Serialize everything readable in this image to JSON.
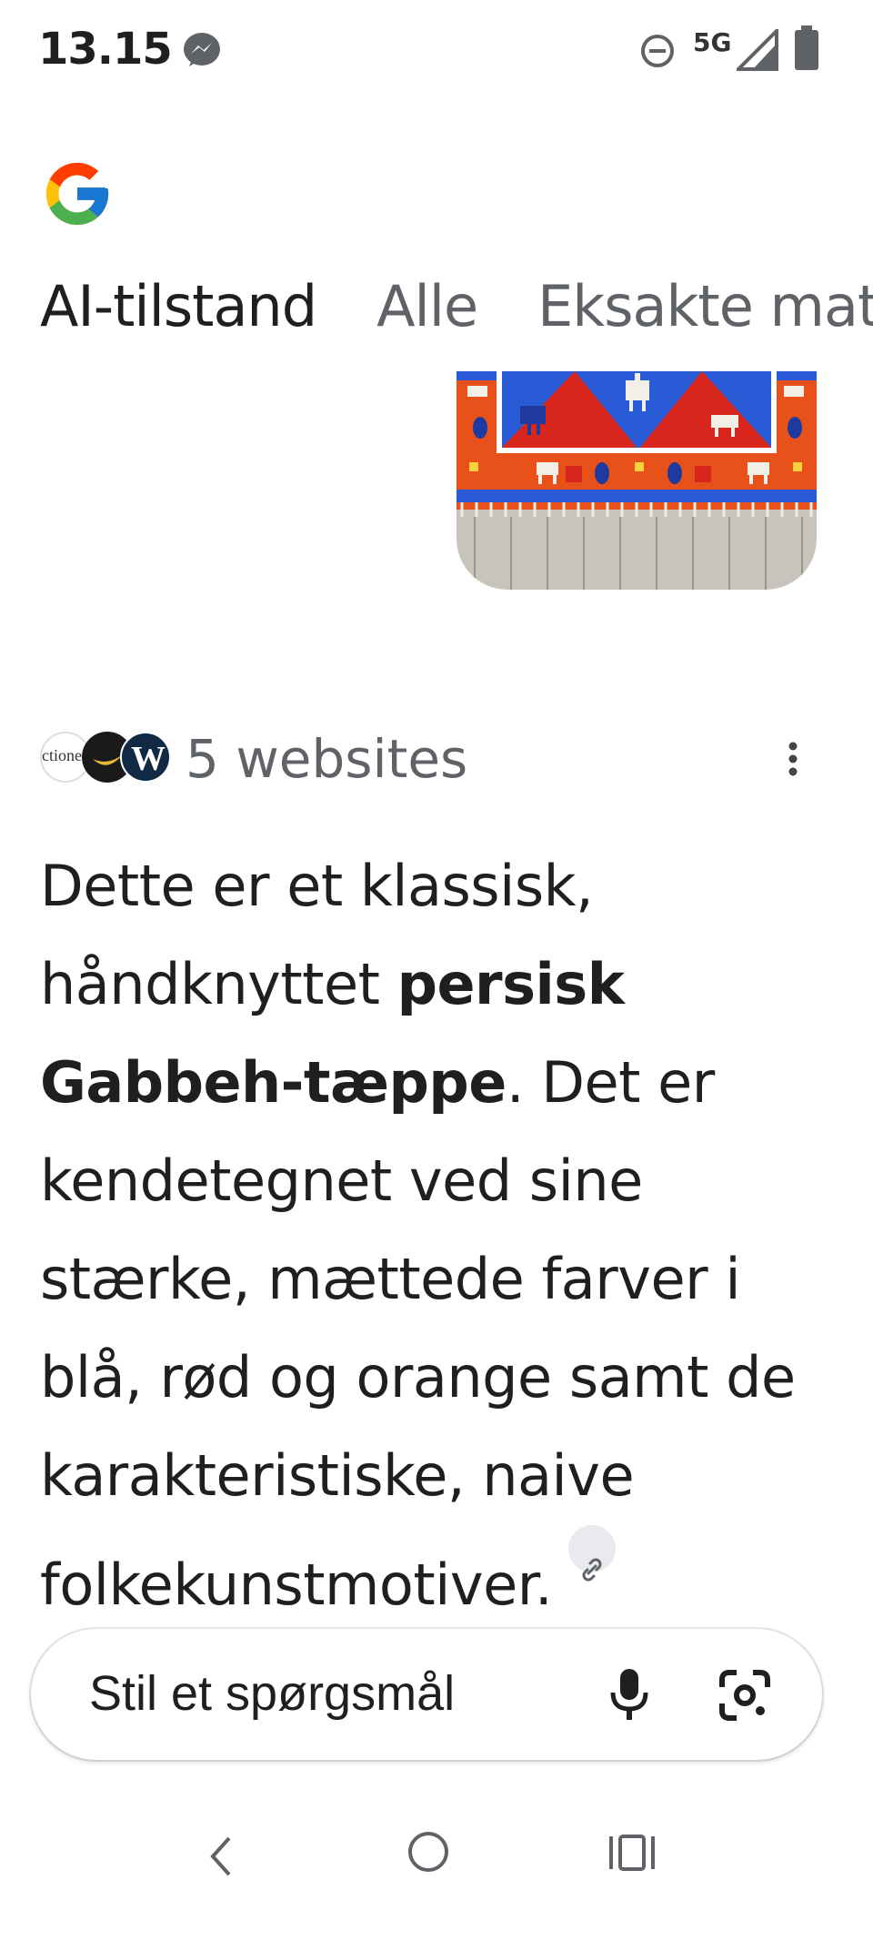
{
  "status_bar": {
    "time": "13.15",
    "network": "5G",
    "icons": [
      "messenger-icon",
      "do-not-disturb-icon",
      "signal-icon",
      "battery-icon"
    ]
  },
  "header": {
    "logo": "google-logo"
  },
  "tabs": [
    {
      "label": "AI-tilstand",
      "active": true
    },
    {
      "label": "Alle",
      "active": false
    },
    {
      "label": "Eksakte mat",
      "active": false
    }
  ],
  "sources": {
    "label": "5 websites",
    "favicon_texts": [
      "ctione",
      "W"
    ]
  },
  "answer": {
    "part1": "Dette er et klassisk, håndknyttet ",
    "bold1": "persisk Gabbeh-tæppe",
    "part2": ". Det er kendetegnet ved sine stærke, mættede farver i blå, rød og orange samt de karakteristiske, naive folkekunstmotiver."
  },
  "ask": {
    "placeholder": "Stil et spørgsmål"
  },
  "colors": {
    "active_tab": "#1f1f1f",
    "inactive_tab": "#5f6368",
    "rug_blue": "#2a5bd7",
    "rug_red": "#d9261c",
    "rug_orange": "#e8521a"
  }
}
